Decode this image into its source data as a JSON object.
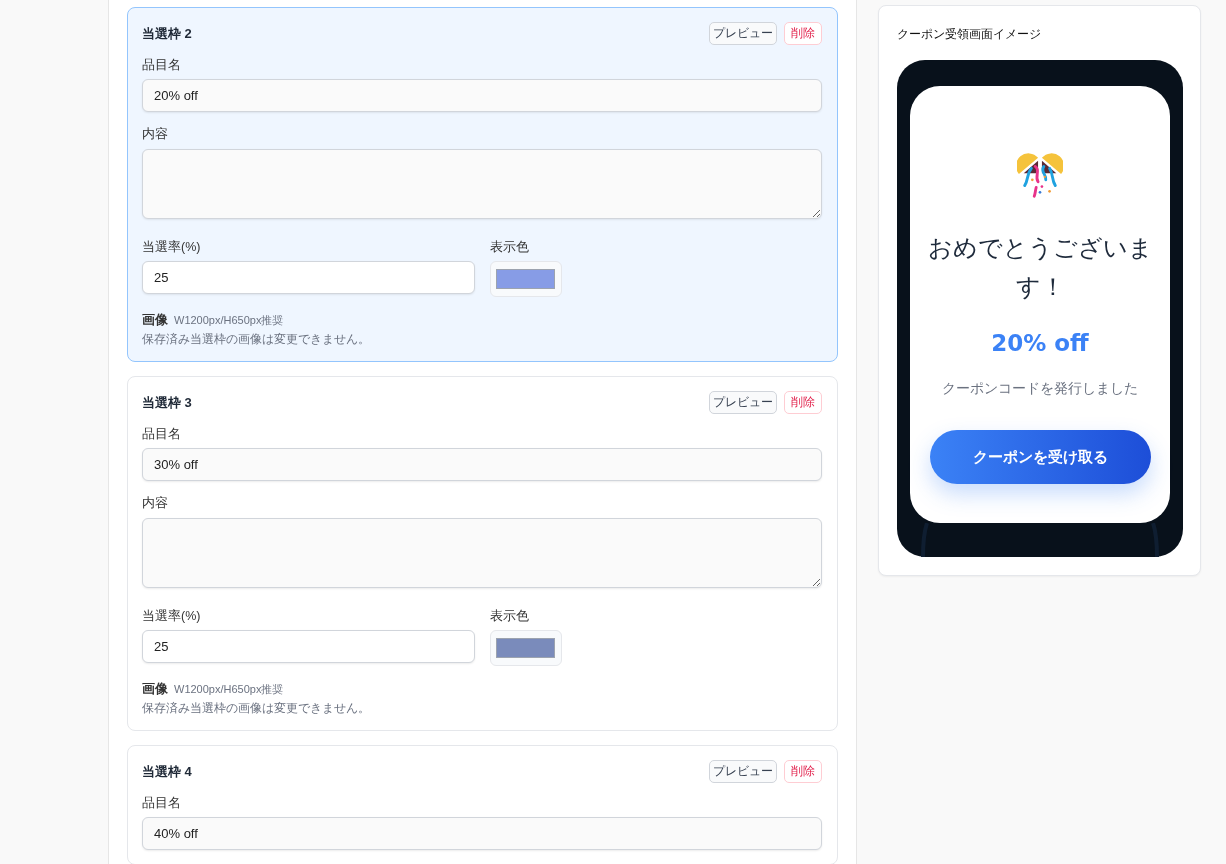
{
  "prize_slots": [
    {
      "title": "当選枠 2",
      "selected": true,
      "buttons": [
        {
          "label": "プレビュー",
          "kind": "preview"
        },
        {
          "label": "削除",
          "kind": "delete"
        }
      ],
      "item_name": {
        "label": "品目名",
        "value": "20% off"
      },
      "content": {
        "label": "内容"
      },
      "win_rate": {
        "label": "当選率(%)",
        "value": "25"
      },
      "display_color": {
        "label": "表示色",
        "color": "#879ce6"
      },
      "image": {
        "label": "画像",
        "hint": "W1200px/H650px推奨",
        "note": "保存済み当選枠の画像は変更できません。"
      }
    },
    {
      "title": "当選枠 3",
      "selected": false,
      "buttons": [
        {
          "label": "プレビュー",
          "kind": "preview"
        },
        {
          "label": "削除",
          "kind": "delete"
        }
      ],
      "item_name": {
        "label": "品目名",
        "value": "30% off"
      },
      "content": {
        "label": "内容"
      },
      "win_rate": {
        "label": "当選率(%)",
        "value": "25"
      },
      "display_color": {
        "label": "表示色",
        "color": "#7a8bbb"
      },
      "image": {
        "label": "画像",
        "hint": "W1200px/H650px推奨",
        "note": "保存済み当選枠の画像は変更できません。"
      }
    },
    {
      "title": "当選枠 4",
      "selected": false,
      "buttons": [
        {
          "label": "プレビュー",
          "kind": "preview"
        },
        {
          "label": "削除",
          "kind": "delete"
        }
      ],
      "item_name": {
        "label": "品目名",
        "value": "40% off"
      }
    }
  ],
  "preview": {
    "title": "クーポン受領画面イメージ",
    "heading": "おめでとうございます！",
    "prize": "20% off",
    "message": "クーポンコードを発行しました",
    "button": "クーポンを受け取る"
  }
}
